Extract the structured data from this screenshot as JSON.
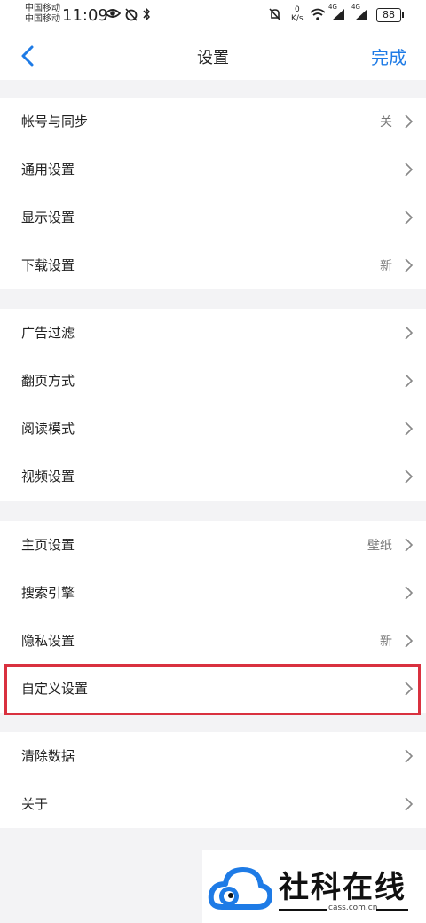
{
  "status_bar": {
    "carrier_1": "中国移动",
    "carrier_2": "中国移动",
    "time": "11:09",
    "net_speed_value": "0",
    "net_speed_unit": "K/s",
    "signal_1": "4G",
    "signal_2": "4G",
    "battery": "88"
  },
  "nav": {
    "title": "设置",
    "done_label": "完成"
  },
  "groups": [
    {
      "items": [
        {
          "label": "帐号与同步",
          "value": "关"
        },
        {
          "label": "通用设置",
          "value": ""
        },
        {
          "label": "显示设置",
          "value": ""
        },
        {
          "label": "下载设置",
          "value": "新"
        }
      ]
    },
    {
      "items": [
        {
          "label": "广告过滤",
          "value": ""
        },
        {
          "label": "翻页方式",
          "value": ""
        },
        {
          "label": "阅读模式",
          "value": ""
        },
        {
          "label": "视频设置",
          "value": ""
        }
      ]
    },
    {
      "items": [
        {
          "label": "主页设置",
          "value": "壁纸"
        },
        {
          "label": "搜索引擎",
          "value": ""
        },
        {
          "label": "隐私设置",
          "value": "新"
        },
        {
          "label": "自定义设置",
          "value": ""
        }
      ]
    },
    {
      "items": [
        {
          "label": "清除数据",
          "value": ""
        },
        {
          "label": "关于",
          "value": ""
        }
      ]
    }
  ],
  "watermark": {
    "text": "社科在线",
    "url": "cass.com.cn"
  },
  "colors": {
    "accent": "#1e7be6",
    "highlight": "#d9313f",
    "background": "#f3f3f5"
  }
}
